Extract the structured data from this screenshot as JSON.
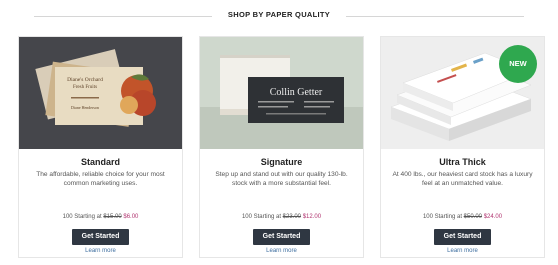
{
  "section": {
    "title": "SHOP BY PAPER QUALITY"
  },
  "cards": [
    {
      "name": "Standard",
      "description": "The affordable, reliable choice for your most common marketing uses.",
      "price_prefix": "100 Starting at",
      "old_price": "$15.00",
      "new_price": "$6.00",
      "button": "Get Started",
      "link": "Learn more",
      "image": {
        "text_line1": "Diane's Orchard",
        "text_line2": "Fresh Fruits",
        "text_line3": "Diane Henderson"
      }
    },
    {
      "name": "Signature",
      "description": "Step up and stand out with our quality 130-lb. stock with a more substantial feel.",
      "price_prefix": "100 Starting at",
      "old_price": "$23.00",
      "new_price": "$12.00",
      "button": "Get Started",
      "link": "Learn more",
      "image": {
        "text_line1": "Collin Getter"
      }
    },
    {
      "name": "Ultra Thick",
      "description": "At 400 lbs., our heaviest card stock has a luxury feel at an unmatched value.",
      "price_prefix": "100 Starting at",
      "old_price": "$50.00",
      "new_price": "$24.00",
      "button": "Get Started",
      "link": "Learn more",
      "badge": "NEW"
    }
  ],
  "colors": {
    "button": "#2f3742",
    "sale_price": "#b0336f",
    "badge": "#2fa84f",
    "link": "#3f6fa0"
  }
}
